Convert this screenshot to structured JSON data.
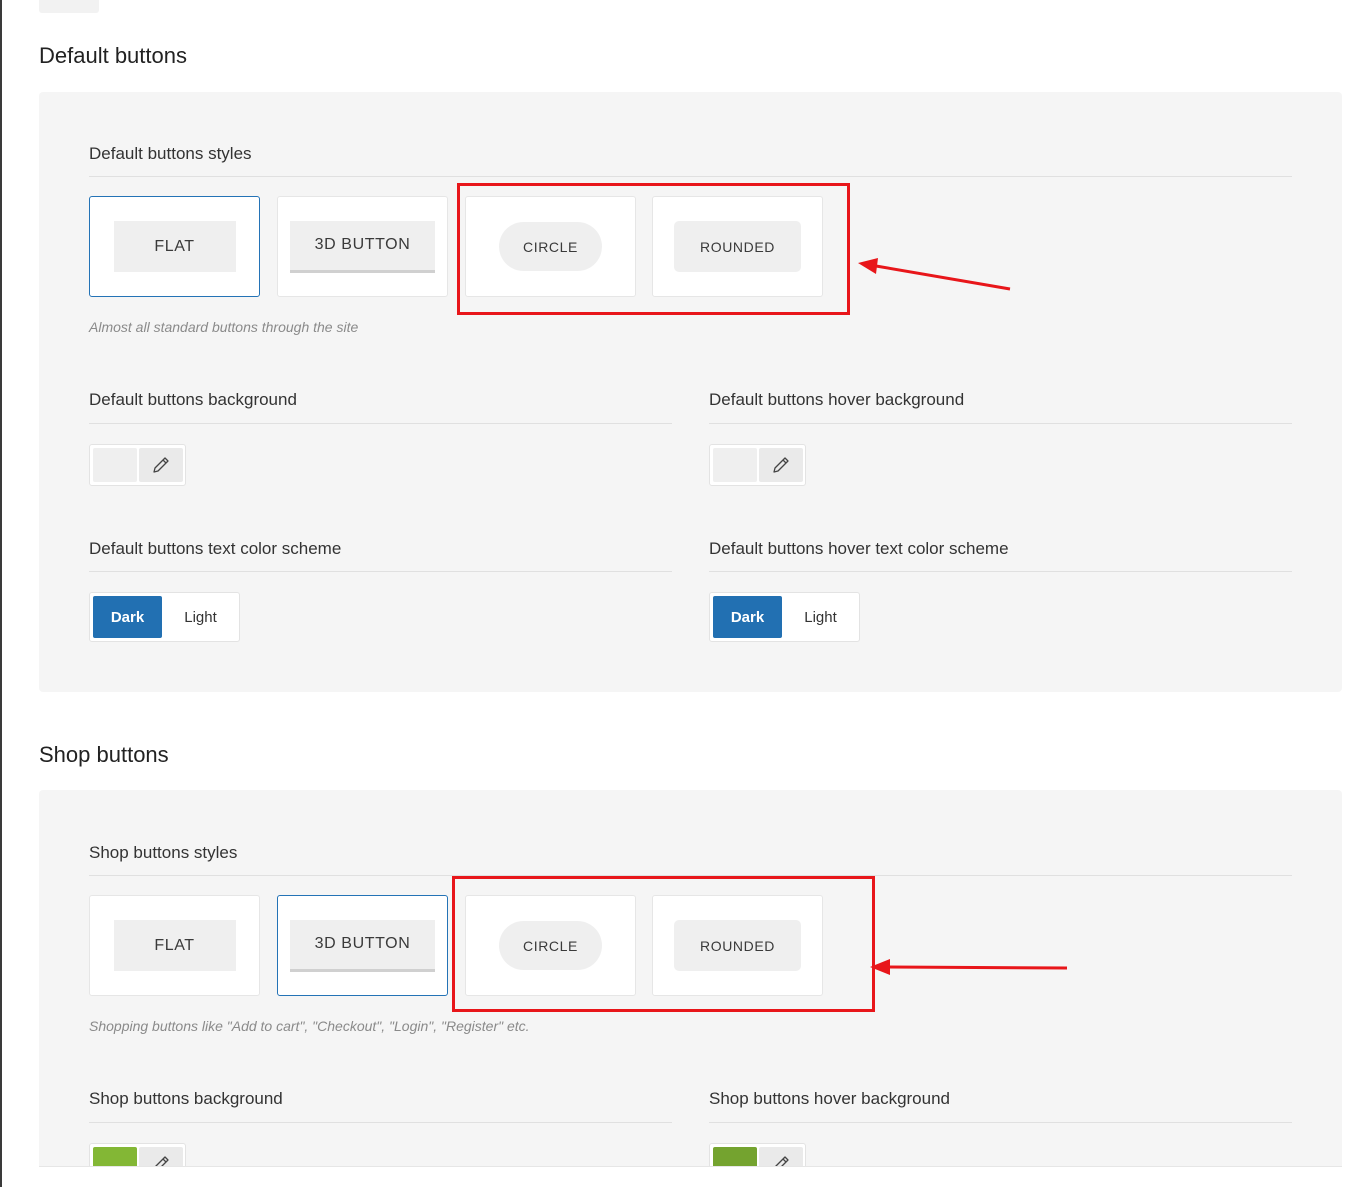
{
  "default_section": {
    "title": "Default buttons",
    "styles_label": "Default buttons styles",
    "style_options": [
      {
        "label": "FLAT",
        "selected": true
      },
      {
        "label": "3D BUTTON",
        "selected": false
      },
      {
        "label": "CIRCLE",
        "selected": false
      },
      {
        "label": "ROUNDED",
        "selected": false
      }
    ],
    "hint": "Almost all standard buttons through the site",
    "background_label": "Default buttons background",
    "background_color": "#efefef",
    "hover_background_label": "Default buttons hover background",
    "hover_background_color": "#efefef",
    "text_scheme_label": "Default buttons text color scheme",
    "text_scheme": {
      "dark": "Dark",
      "light": "Light",
      "selected": "Dark"
    },
    "hover_text_scheme_label": "Default buttons hover text color scheme",
    "hover_text_scheme": {
      "dark": "Dark",
      "light": "Light",
      "selected": "Dark"
    }
  },
  "shop_section": {
    "title": "Shop buttons",
    "styles_label": "Shop buttons styles",
    "style_options": [
      {
        "label": "FLAT",
        "selected": false
      },
      {
        "label": "3D BUTTON",
        "selected": true
      },
      {
        "label": "CIRCLE",
        "selected": false
      },
      {
        "label": "ROUNDED",
        "selected": false
      }
    ],
    "hint": "Shopping buttons like \"Add to cart\", \"Checkout\", \"Login\", \"Register\" etc.",
    "background_label": "Shop buttons background",
    "background_color": "#83b735",
    "hover_background_label": "Shop buttons hover background",
    "hover_background_color": "#74a32f"
  },
  "icons": {
    "color_picker": "eyedropper-icon"
  },
  "colors": {
    "accent": "#2270b2",
    "annotation": "#e8161a",
    "panel": "#f5f5f5"
  }
}
